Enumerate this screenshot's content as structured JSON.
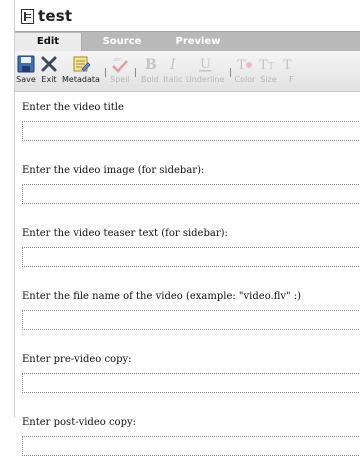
{
  "window": {
    "title": "test"
  },
  "tabs": [
    {
      "label": "Edit",
      "active": true
    },
    {
      "label": "Source",
      "active": false
    },
    {
      "label": "Preview",
      "active": false
    }
  ],
  "toolbar": {
    "items": [
      {
        "label": "Save",
        "icon": "save-icon",
        "enabled": true
      },
      {
        "label": "Exit",
        "icon": "close-icon",
        "enabled": true
      },
      {
        "label": "Metadata",
        "icon": "metadata-icon",
        "enabled": true
      },
      {
        "label": "Spell",
        "icon": "spell-check-icon",
        "enabled": false
      },
      {
        "label": "Bold",
        "icon": "bold-icon",
        "enabled": false
      },
      {
        "label": "Italic",
        "icon": "italic-icon",
        "enabled": false
      },
      {
        "label": "Underline",
        "icon": "underline-icon",
        "enabled": false
      },
      {
        "label": "Color",
        "icon": "text-color-icon",
        "enabled": false
      },
      {
        "label": "Size",
        "icon": "text-size-icon",
        "enabled": false
      },
      {
        "label": "F",
        "icon": "font-icon",
        "enabled": false
      }
    ]
  },
  "fields": [
    {
      "label": "Enter the video title",
      "value": ""
    },
    {
      "label": "Enter the video image (for sidebar):",
      "value": ""
    },
    {
      "label": "Enter the video teaser text (for sidebar):",
      "value": ""
    },
    {
      "label": "Enter the file name of the video (example: \"video.flv\" :)",
      "value": ""
    },
    {
      "label": "Enter pre-video copy:",
      "value": ""
    },
    {
      "label": "Enter post-video copy:",
      "value": ""
    }
  ],
  "colors": {
    "tab_bar": "#b9b9b9",
    "active_tab": "#ececec",
    "disabled_text": "#b8b8b8"
  }
}
